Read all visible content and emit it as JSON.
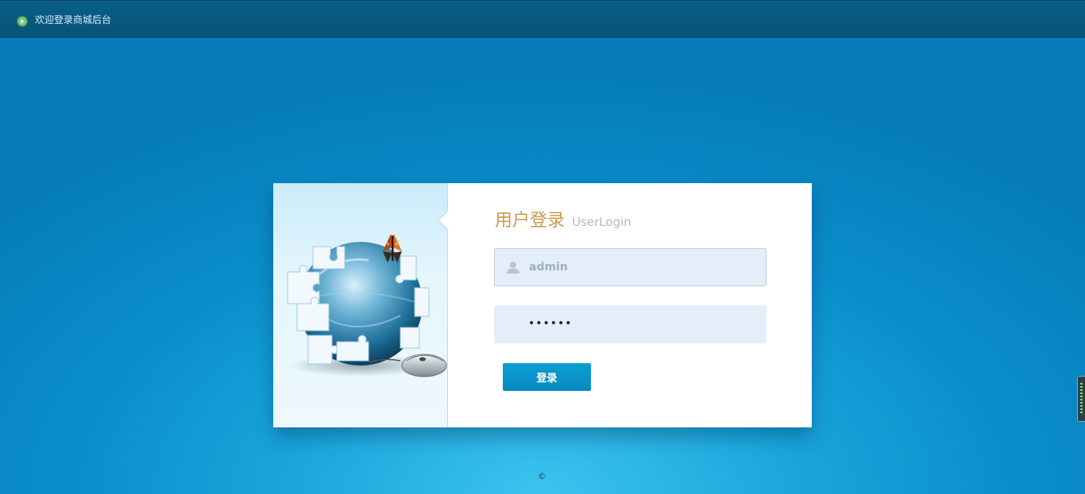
{
  "topbar": {
    "title": "欢迎登录商城后台",
    "icon": "play-circle-icon"
  },
  "login": {
    "title_cn": "用户登录",
    "title_en": "UserLogin",
    "username": {
      "value": "admin",
      "icon": "user-icon"
    },
    "password": {
      "value": "••••••"
    },
    "submit_label": "登录"
  },
  "footer": {
    "copyright": "©"
  },
  "colors": {
    "topbar": "#075378",
    "background": "#0a8fcb",
    "heading": "#c69b4e",
    "button": "#0997cc",
    "field": "#e4eefa"
  }
}
